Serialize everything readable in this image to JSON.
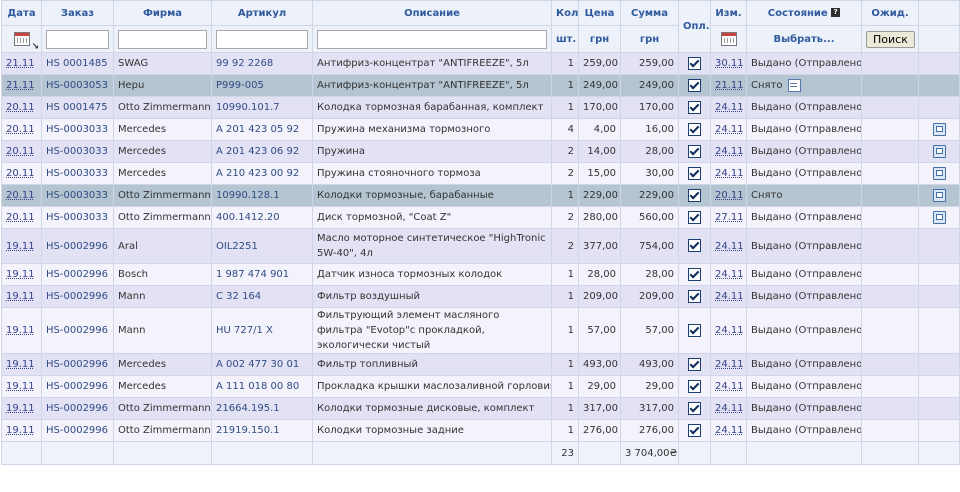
{
  "header": {
    "date": "Дата",
    "order": "Заказ",
    "firm": "Фирма",
    "article": "Артикул",
    "description": "Описание",
    "qty": "Кол",
    "qty_unit": "шт.",
    "price": "Цена",
    "price_unit": "грн",
    "sum": "Сумма",
    "sum_unit": "грн",
    "paid": "Опл.",
    "changed": "Изм.",
    "status": "Состояние",
    "status_select": "Выбрать...",
    "wait": "Ожид.",
    "search_button": "Поиск"
  },
  "filters": {
    "order": "",
    "firm": "",
    "article": "",
    "description": ""
  },
  "rows": [
    {
      "date": "21.11",
      "order": "HS 0001485",
      "firm": "SWAG",
      "article": "99 92 2268",
      "description": "Антифриз-концентрат \"ANTIFREEZE\", 5л",
      "qty": "1",
      "price": "259,00",
      "sum": "259,00",
      "paid": true,
      "changed": "30.11",
      "status": "Выдано (Отправлено)",
      "note": false,
      "msg": false,
      "highlight": false,
      "tall": false
    },
    {
      "date": "21.11",
      "order": "HS-0003053",
      "firm": "Hepu",
      "article": "P999-005",
      "description": "Антифриз-концентрат \"ANTIFREEZE\", 5л",
      "qty": "1",
      "price": "249,00",
      "sum": "249,00",
      "paid": true,
      "changed": "21.11",
      "status": "Снято",
      "note": true,
      "msg": false,
      "highlight": true,
      "tall": false
    },
    {
      "date": "20.11",
      "order": "HS 0001475",
      "firm": "Otto Zimmermann",
      "article": "10990.101.7",
      "description": "Колодка тормозная барабанная, комплект",
      "qty": "1",
      "price": "170,00",
      "sum": "170,00",
      "paid": true,
      "changed": "24.11",
      "status": "Выдано (Отправлено)",
      "note": false,
      "msg": false,
      "highlight": false,
      "tall": false
    },
    {
      "date": "20.11",
      "order": "HS-0003033",
      "firm": "Mercedes",
      "article": "A 201 423 05 92",
      "description": "Пружина механизма тормозного",
      "qty": "4",
      "price": "4,00",
      "sum": "16,00",
      "paid": true,
      "changed": "24.11",
      "status": "Выдано (Отправлено)",
      "note": false,
      "msg": true,
      "highlight": false,
      "tall": false
    },
    {
      "date": "20.11",
      "order": "HS-0003033",
      "firm": "Mercedes",
      "article": "A 201 423 06 92",
      "description": "Пружина",
      "qty": "2",
      "price": "14,00",
      "sum": "28,00",
      "paid": true,
      "changed": "24.11",
      "status": "Выдано (Отправлено)",
      "note": false,
      "msg": true,
      "highlight": false,
      "tall": false
    },
    {
      "date": "20.11",
      "order": "HS-0003033",
      "firm": "Mercedes",
      "article": "A 210 423 00 92",
      "description": "Пружина стояночного тормоза",
      "qty": "2",
      "price": "15,00",
      "sum": "30,00",
      "paid": true,
      "changed": "24.11",
      "status": "Выдано (Отправлено)",
      "note": false,
      "msg": true,
      "highlight": false,
      "tall": false
    },
    {
      "date": "20.11",
      "order": "HS-0003033",
      "firm": "Otto Zimmermann",
      "article": "10990.128.1",
      "description": "Колодки тормозные, барабанные",
      "qty": "1",
      "price": "229,00",
      "sum": "229,00",
      "paid": true,
      "changed": "20.11",
      "status": "Снято",
      "note": false,
      "msg": true,
      "highlight": true,
      "tall": false
    },
    {
      "date": "20.11",
      "order": "HS-0003033",
      "firm": "Otto Zimmermann",
      "article": "400.1412.20",
      "description": "Диск тормозной, \"Coat Z\"",
      "qty": "2",
      "price": "280,00",
      "sum": "560,00",
      "paid": true,
      "changed": "27.11",
      "status": "Выдано (Отправлено)",
      "note": false,
      "msg": true,
      "highlight": false,
      "tall": false
    },
    {
      "date": "19.11",
      "order": "HS-0002996",
      "firm": "Aral",
      "article": "OIL2251",
      "description": "Масло моторное синтетическое \"HighTronic 5W-40\", 4л",
      "qty": "2",
      "price": "377,00",
      "sum": "754,00",
      "paid": true,
      "changed": "24.11",
      "status": "Выдано (Отправлено)",
      "note": false,
      "msg": false,
      "highlight": false,
      "tall": true
    },
    {
      "date": "19.11",
      "order": "HS-0002996",
      "firm": "Bosch",
      "article": "1 987 474 901",
      "description": "Датчик износа тормозных колодок",
      "qty": "1",
      "price": "28,00",
      "sum": "28,00",
      "paid": true,
      "changed": "24.11",
      "status": "Выдано (Отправлено)",
      "note": false,
      "msg": false,
      "highlight": false,
      "tall": false
    },
    {
      "date": "19.11",
      "order": "HS-0002996",
      "firm": "Mann",
      "article": "C 32 164",
      "description": "Фильтр воздушный",
      "qty": "1",
      "price": "209,00",
      "sum": "209,00",
      "paid": true,
      "changed": "24.11",
      "status": "Выдано (Отправлено)",
      "note": false,
      "msg": false,
      "highlight": false,
      "tall": false
    },
    {
      "date": "19.11",
      "order": "HS-0002996",
      "firm": "Mann",
      "article": "HU 727/1 X",
      "description": "Фильтрующий элемент масляного фильтра \"Evotop\"с прокладкой, экологически чистый",
      "qty": "1",
      "price": "57,00",
      "sum": "57,00",
      "paid": true,
      "changed": "24.11",
      "status": "Выдано (Отправлено)",
      "note": false,
      "msg": false,
      "highlight": false,
      "tall": true
    },
    {
      "date": "19.11",
      "order": "HS-0002996",
      "firm": "Mercedes",
      "article": "A 002 477 30 01",
      "description": "Фильтр топливный",
      "qty": "1",
      "price": "493,00",
      "sum": "493,00",
      "paid": true,
      "changed": "24.11",
      "status": "Выдано (Отправлено)",
      "note": false,
      "msg": false,
      "highlight": false,
      "tall": false
    },
    {
      "date": "19.11",
      "order": "HS-0002996",
      "firm": "Mercedes",
      "article": "A 111 018 00 80",
      "description": "Прокладка крышки маслозаливной горловины",
      "qty": "1",
      "price": "29,00",
      "sum": "29,00",
      "paid": true,
      "changed": "24.11",
      "status": "Выдано (Отправлено)",
      "note": false,
      "msg": false,
      "highlight": false,
      "tall": false
    },
    {
      "date": "19.11",
      "order": "HS-0002996",
      "firm": "Otto Zimmermann",
      "article": "21664.195.1",
      "description": "Колодки тормозные дисковые, комплект",
      "qty": "1",
      "price": "317,00",
      "sum": "317,00",
      "paid": true,
      "changed": "24.11",
      "status": "Выдано (Отправлено)",
      "note": false,
      "msg": false,
      "highlight": false,
      "tall": false
    },
    {
      "date": "19.11",
      "order": "HS-0002996",
      "firm": "Otto Zimmermann",
      "article": "21919.150.1",
      "description": "Колодки тормозные задние",
      "qty": "1",
      "price": "276,00",
      "sum": "276,00",
      "paid": true,
      "changed": "24.11",
      "status": "Выдано (Отправлено)",
      "note": false,
      "msg": false,
      "highlight": false,
      "tall": false
    }
  ],
  "totals": {
    "qty": "23",
    "sum": "3 704,00₴"
  },
  "colors": {
    "row_odd": "#e3e2f5",
    "row_even": "#f4f2fb",
    "row_highlight": "#b4c4d0",
    "header_text": "#2f5a9e"
  }
}
